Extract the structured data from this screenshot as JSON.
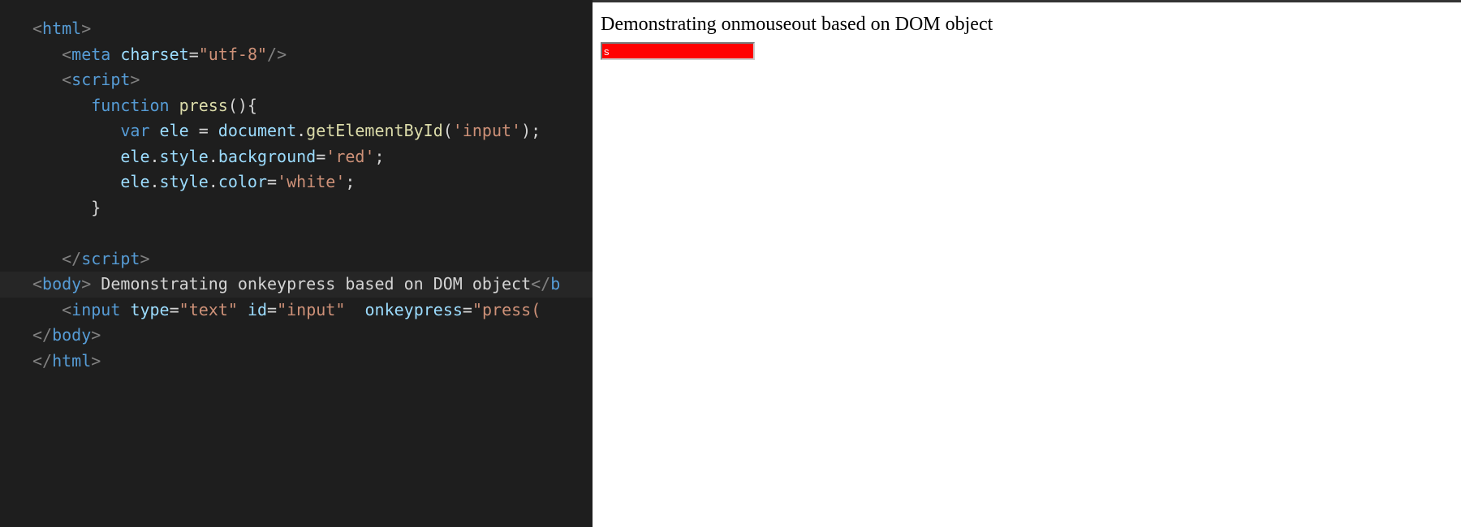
{
  "editor": {
    "lines": {
      "l1_open": "<",
      "l1_tag": "html",
      "l1_close": ">",
      "l2_open": "<",
      "l2_tag": "meta",
      "l2_attr": "charset",
      "l2_eq": "=",
      "l2_val": "\"utf-8\"",
      "l2_close": "/>",
      "l3_open": "<",
      "l3_tag": "script",
      "l3_close": ">",
      "l4_kw": "function",
      "l4_fn": "press",
      "l4_paren": "(){",
      "l5_kw": "var",
      "l5_var": "ele",
      "l5_eq": " = ",
      "l5_obj": "document",
      "l5_dot": ".",
      "l5_method": "getElementById",
      "l5_open": "(",
      "l5_arg": "'input'",
      "l5_close": ");",
      "l6_var": "ele",
      "l6_dot1": ".",
      "l6_p1": "style",
      "l6_dot2": ".",
      "l6_p2": "background",
      "l6_eq": "=",
      "l6_val": "'red'",
      "l6_semi": ";",
      "l7_var": "ele",
      "l7_dot1": ".",
      "l7_p1": "style",
      "l7_dot2": ".",
      "l7_p2": "color",
      "l7_eq": "=",
      "l7_val": "'white'",
      "l7_semi": ";",
      "l8_brace": "}",
      "l10_open": "</",
      "l10_tag": "script",
      "l10_close": ">",
      "l11_open": "<",
      "l11_tag": "body",
      "l11_close": ">",
      "l11_text": " Demonstrating onkeypress based on DOM object",
      "l11_endopen": "</",
      "l11_endtag": "b",
      "l12_open": "<",
      "l12_tag": "input",
      "l12_attr1": "type",
      "l12_eq1": "=",
      "l12_val1": "\"text\"",
      "l12_attr2": "id",
      "l12_eq2": "=",
      "l12_val2": "\"input\"",
      "l12_attr3": "onkeypress",
      "l12_eq3": "=",
      "l12_val3": "\"press(",
      "l13_open": "</",
      "l13_tag": "body",
      "l13_close": ">",
      "l14_open": "</",
      "l14_tag": "html",
      "l14_close": ">"
    }
  },
  "preview": {
    "heading": "Demonstrating onmouseout based on DOM object",
    "input_value": "s"
  }
}
